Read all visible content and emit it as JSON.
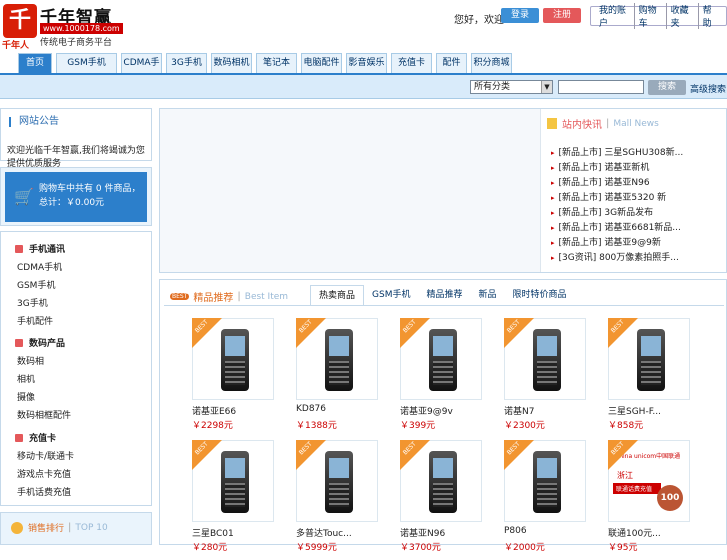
{
  "logo": {
    "mark": "千",
    "name": "千年智赢",
    "url": "www.1000178.com",
    "slogan": "传统电子商务平台",
    "sub": "千年人"
  },
  "header": {
    "welcome": "您好，欢迎",
    "login": "登录",
    "register": "注册",
    "links": [
      "我的账户",
      "购物车",
      "收藏夹",
      "帮助"
    ]
  },
  "nav": {
    "tabs": [
      "首页",
      "GSM手机",
      "CDMA手机",
      "3G手机",
      "数码相机",
      "笔记本",
      "电脑配件",
      "影音娱乐",
      "充值卡",
      "配件",
      "积分商城"
    ]
  },
  "search": {
    "category": "所有分类",
    "button": "搜索",
    "advanced": "高级搜索"
  },
  "notice": {
    "title": "网站公告",
    "text": "欢迎光临千年智赢,我们将竭诚为您提供优质服务"
  },
  "cart": {
    "text": "购物车中共有 0 件商品，总计：￥0.00元"
  },
  "categories": [
    {
      "title": "手机通讯",
      "items": [
        "CDMA手机",
        "GSM手机",
        "3G手机",
        "手机配件"
      ]
    },
    {
      "title": "数码产品",
      "items": [
        "数码相",
        "相机",
        "摄像",
        "数码相框配件"
      ]
    },
    {
      "title": "充值卡",
      "items": [
        "移动卡/联通卡",
        "游戏点卡充值",
        "手机话费充值"
      ]
    }
  ],
  "news": {
    "title": "站内快讯",
    "title_en": "Mall News",
    "items": [
      "[新品上市] 三星SGHU308新...",
      "[新品上市] 诺基亚新机",
      "[新品上市] 诺基亚N96",
      "[新品上市] 诺基亚5320 新",
      "[新品上市] 3G新品发布",
      "[新品上市] 诺基亚6681新品...",
      "[新品上市] 诺基亚9@9新",
      "[3G资讯] 800万像素拍照手..."
    ]
  },
  "products": {
    "badge": "BEST",
    "title": "精品推荐",
    "title_en": "Best Item",
    "tabs": [
      "热卖商品",
      "GSM手机",
      "精品推荐",
      "新品",
      "限时特价商品"
    ],
    "ribbon": "BEST",
    "items": [
      {
        "name": "诺基亚E66",
        "price": "￥2298元"
      },
      {
        "name": "KD876",
        "price": "￥1388元"
      },
      {
        "name": "诺基亚9@9v",
        "price": "￥399元"
      },
      {
        "name": "诺基N7",
        "price": "￥2300元"
      },
      {
        "name": "三星SGH-F...",
        "price": "￥858元"
      },
      {
        "name": "三星BC01",
        "price": "￥280元"
      },
      {
        "name": "多普达Touc...",
        "price": "￥5999元"
      },
      {
        "name": "诺基亚N96",
        "price": "￥3700元"
      },
      {
        "name": "P806",
        "price": "￥2000元"
      },
      {
        "name": "联通100元...",
        "price": "￥95元"
      }
    ],
    "unicom": {
      "brand": "China unicom中国联通",
      "region": "浙江",
      "card": "联通话费充值",
      "value": "100"
    }
  },
  "sales": {
    "title": "销售排行",
    "title_en": "TOP 10"
  },
  "colors": {
    "accent": "#2c7fcb",
    "price": "#cc0000",
    "ribbon": "#f29530"
  }
}
